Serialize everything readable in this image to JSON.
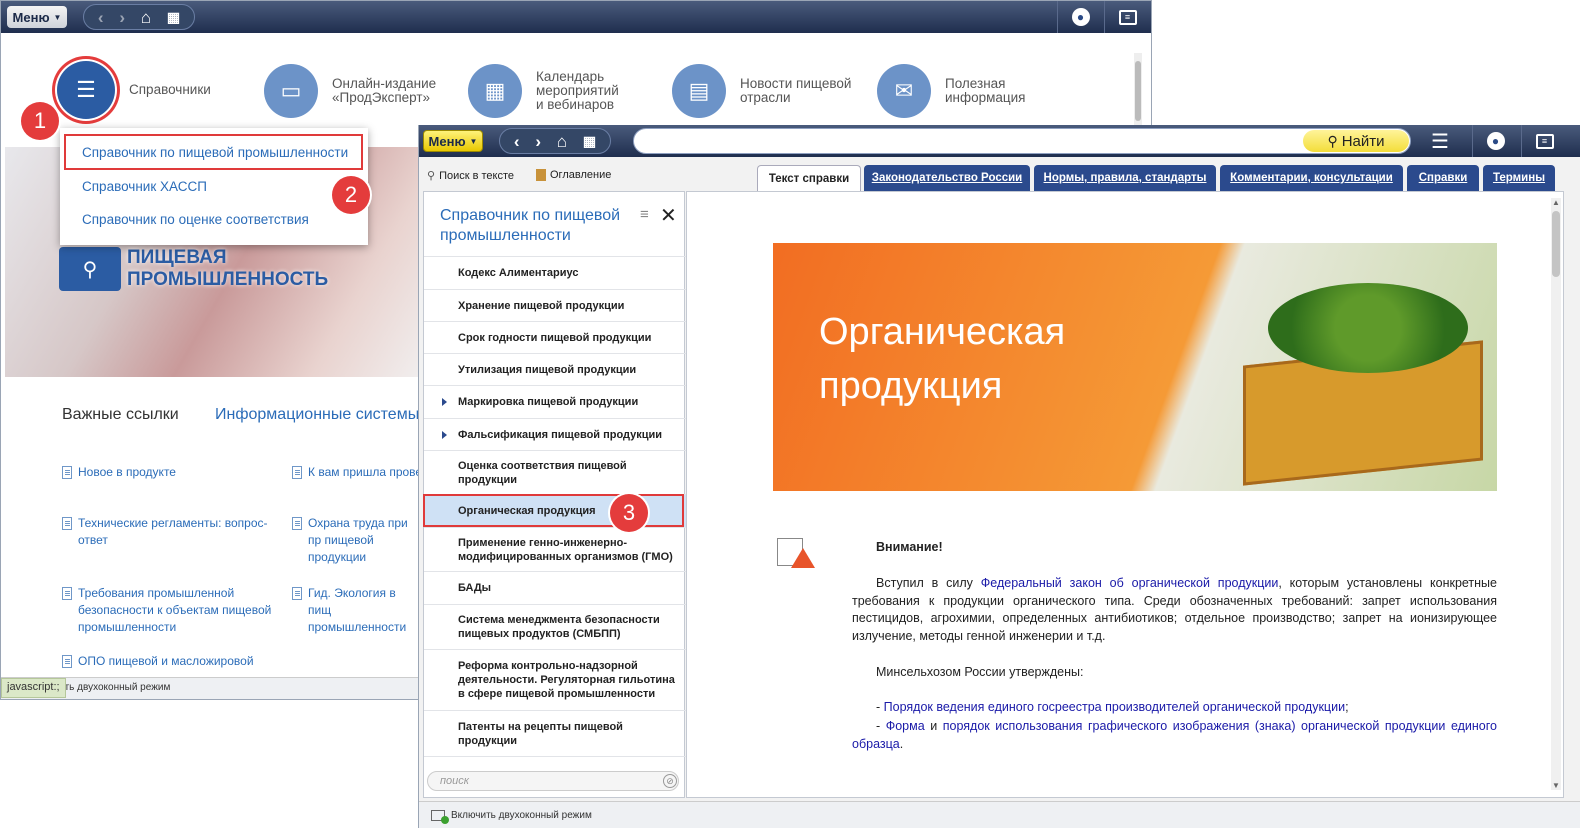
{
  "back_window": {
    "menu_label": "Меню",
    "categories": [
      {
        "label": "Справочники",
        "icon": "list-icon"
      },
      {
        "label_lines": [
          "Онлайн-издание",
          "«ПродЭксперт»"
        ],
        "icon": "monitor-icon"
      },
      {
        "label_lines": [
          "Календарь",
          "мероприятий",
          "и вебинаров"
        ],
        "icon": "calendar-icon"
      },
      {
        "label_lines": [
          "Новости пищевой",
          "отрасли"
        ],
        "icon": "newspaper-icon"
      },
      {
        "label_lines": [
          "Полезная",
          "информация"
        ],
        "icon": "info-icon"
      }
    ],
    "dropdown": [
      "Справочник по пищевой промышленности",
      "Справочник ХАССП",
      "Справочник по оценке соответствия"
    ],
    "hero_text": [
      "ПИЩЕВАЯ",
      "ПРОМЫШЛЕННОСТЬ"
    ],
    "tabs": [
      "Важные ссылки",
      "Информационные системы"
    ],
    "links_col1": [
      "Новое в продукте",
      "Технические регламенты: вопрос-ответ",
      "Требования промышленной безопасности к объектам пищевой промышленности",
      "ОПО пищевой и масложировой"
    ],
    "links_col2": [
      "К вам пришла прове",
      "Охрана труда при пр пищевой продукции",
      "Гид. Экология в пищ промышленности"
    ],
    "status_text": "ить двухоконный режим",
    "status_tooltip": "javascript:;"
  },
  "front_window": {
    "menu_label": "Меню",
    "search_button": "Найти",
    "toolbar": {
      "search_in_text": "Поиск в тексте",
      "contents": "Оглавление"
    },
    "tabs": [
      "Текст справки",
      "Законодательство России",
      "Нормы, правила, стандарты",
      "Комментарии, консультации",
      "Справки",
      "Термины"
    ],
    "toc_title": "Справочник по пищевой промышленности",
    "toc_items": [
      {
        "label": "Кодекс Алиментариус",
        "expandable": false
      },
      {
        "label": "Хранение пищевой продукции",
        "expandable": false
      },
      {
        "label": "Срок годности пищевой продукции",
        "expandable": false
      },
      {
        "label": "Утилизация пищевой продукции",
        "expandable": false
      },
      {
        "label": "Маркировка пищевой продукции",
        "expandable": true
      },
      {
        "label": "Фальсификация пищевой продукции",
        "expandable": true
      },
      {
        "label": "Оценка соответствия пищевой продукции",
        "expandable": false
      },
      {
        "label": "Органическая продукция",
        "expandable": false,
        "selected": true
      },
      {
        "label": "Применение генно-инженерно-модифицированных организмов (ГМО)",
        "expandable": false
      },
      {
        "label": "БАДы",
        "expandable": false
      },
      {
        "label": "Система менеджмента безопасности пищевых продуктов (СМБПП)",
        "expandable": false
      },
      {
        "label": "Реформа контрольно-надзорной деятельности. Регуляторная гильотина в сфере пищевой промышленности",
        "expandable": false
      },
      {
        "label": "Патенты на рецепты пищевой продукции",
        "expandable": false
      }
    ],
    "toc_search_placeholder": "поиск",
    "banner_title": [
      "Органическая",
      "продукция"
    ],
    "attention": "Внимание!",
    "para1": {
      "prefix": "Вступил в силу ",
      "link": "Федеральный закон об органической продукции",
      "suffix": ", которым установлены конкретные требования к продукции органического типа. Среди обозначенных требований: запрет использования пестицидов, агрохимии, определенных антибиотиков; отдельное производство; запрет на ионизирующее излучение, методы генной инженерии и т.д."
    },
    "para2": "Минсельхозом России утверждены:",
    "list1": {
      "dash": "- ",
      "link": "Порядок ведения единого госреестра производителей органической продукции",
      "end": ";"
    },
    "list2": {
      "dash": "- ",
      "link1": "Форма",
      "mid": " и ",
      "link2": "порядок использования графического изображения (знака) органической продукции единого образца",
      "end": "."
    },
    "status_text": "Включить двухоконный режим"
  },
  "badges": [
    "1",
    "2",
    "3"
  ],
  "colors": {
    "accent_blue": "#2b4a8d",
    "highlight_red": "#e03a3a",
    "banner_orange": "#f08a24",
    "menu_yellow": "#f5d400"
  }
}
